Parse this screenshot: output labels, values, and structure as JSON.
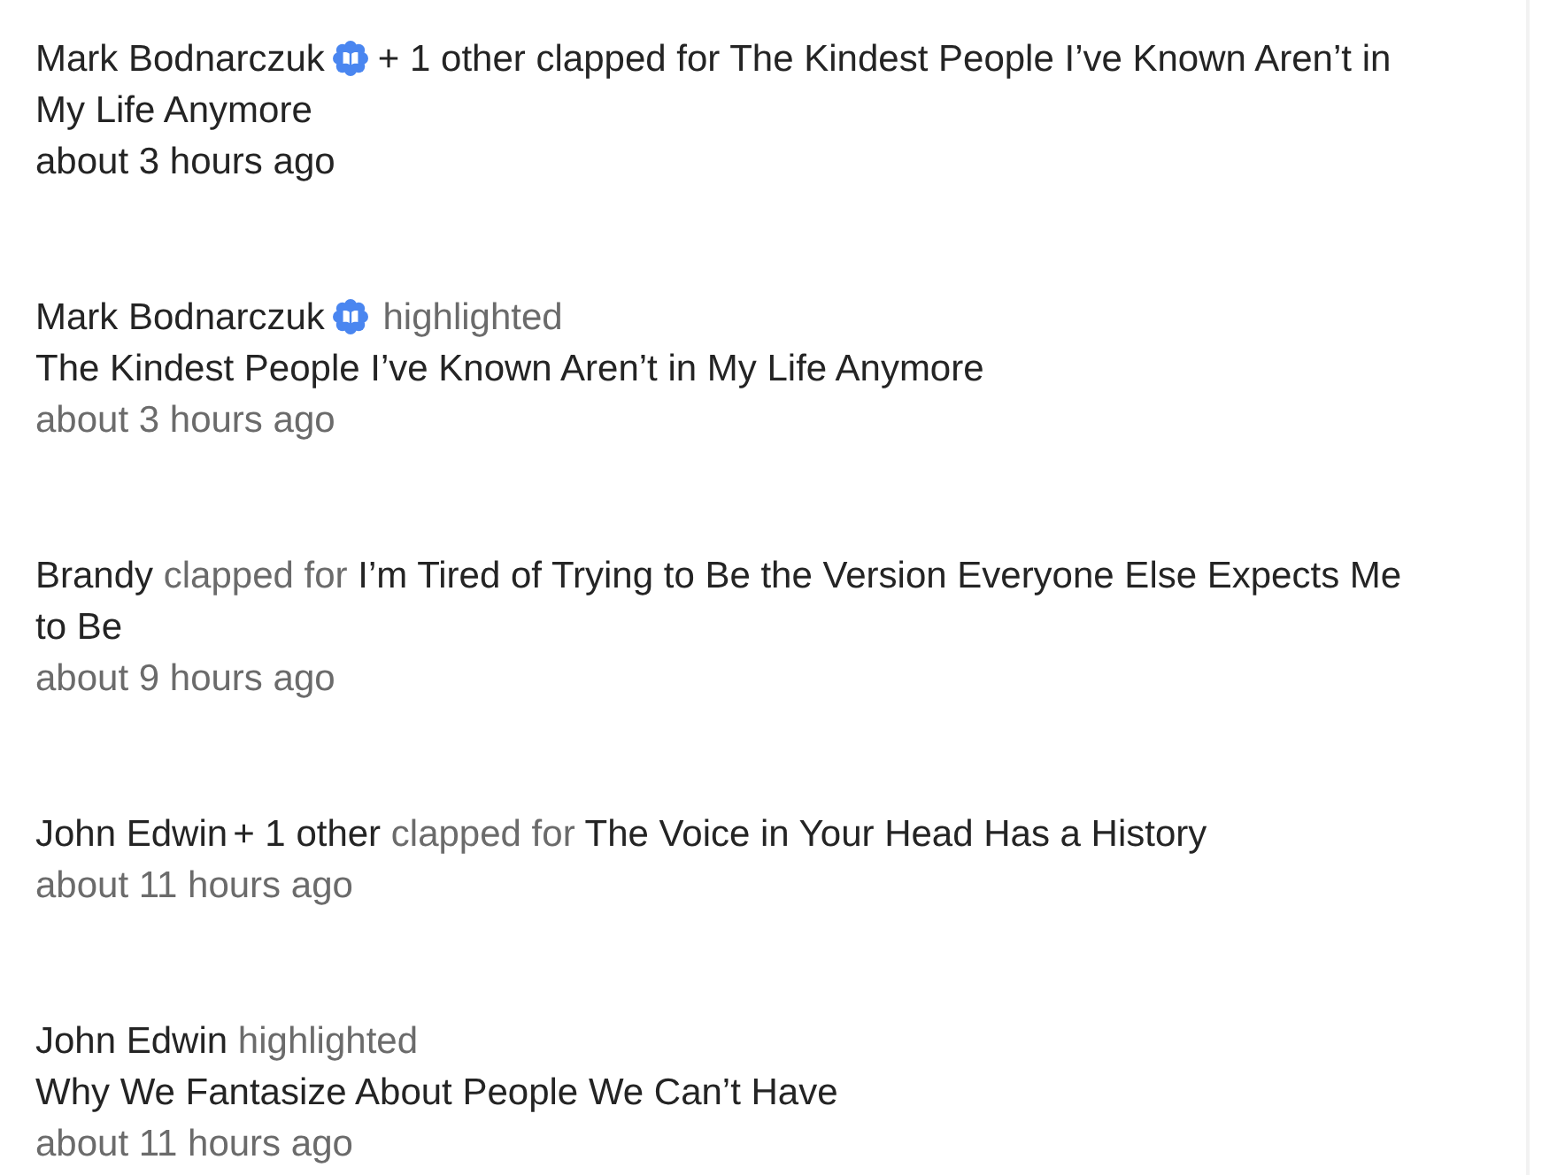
{
  "notifications": [
    {
      "kind": "clap",
      "unread": true,
      "actor": "Mark Bodnarczuk",
      "badge": true,
      "others": "+ 1 other",
      "action": "clapped for",
      "story": "The Kindest People I’ve Known Aren’t in My Life Anymore",
      "time": "about 3 hours ago"
    },
    {
      "kind": "highlight",
      "unread": false,
      "actor": "Mark Bodnarczuk",
      "badge": true,
      "action": "highlighted",
      "story": "The Kindest People I’ve Known Aren’t in My Life Anymore",
      "time": "about 3 hours ago"
    },
    {
      "kind": "clap",
      "unread": false,
      "actor": "Brandy",
      "badge": false,
      "action": "clapped for",
      "story": "I’m Tired of Trying to Be the Version Everyone Else Expects Me to Be",
      "time": "about 9 hours ago"
    },
    {
      "kind": "clap",
      "unread": false,
      "actor": "John Edwin",
      "badge": false,
      "others": "+ 1 other",
      "action": "clapped for",
      "story": "The Voice in Your Head Has a History",
      "time": "about 11 hours ago"
    },
    {
      "kind": "highlight",
      "unread": false,
      "actor": "John Edwin",
      "badge": false,
      "action": "highlighted",
      "story": "Why We Fantasize About People We Can’t Have",
      "time": "about 11 hours ago"
    }
  ]
}
